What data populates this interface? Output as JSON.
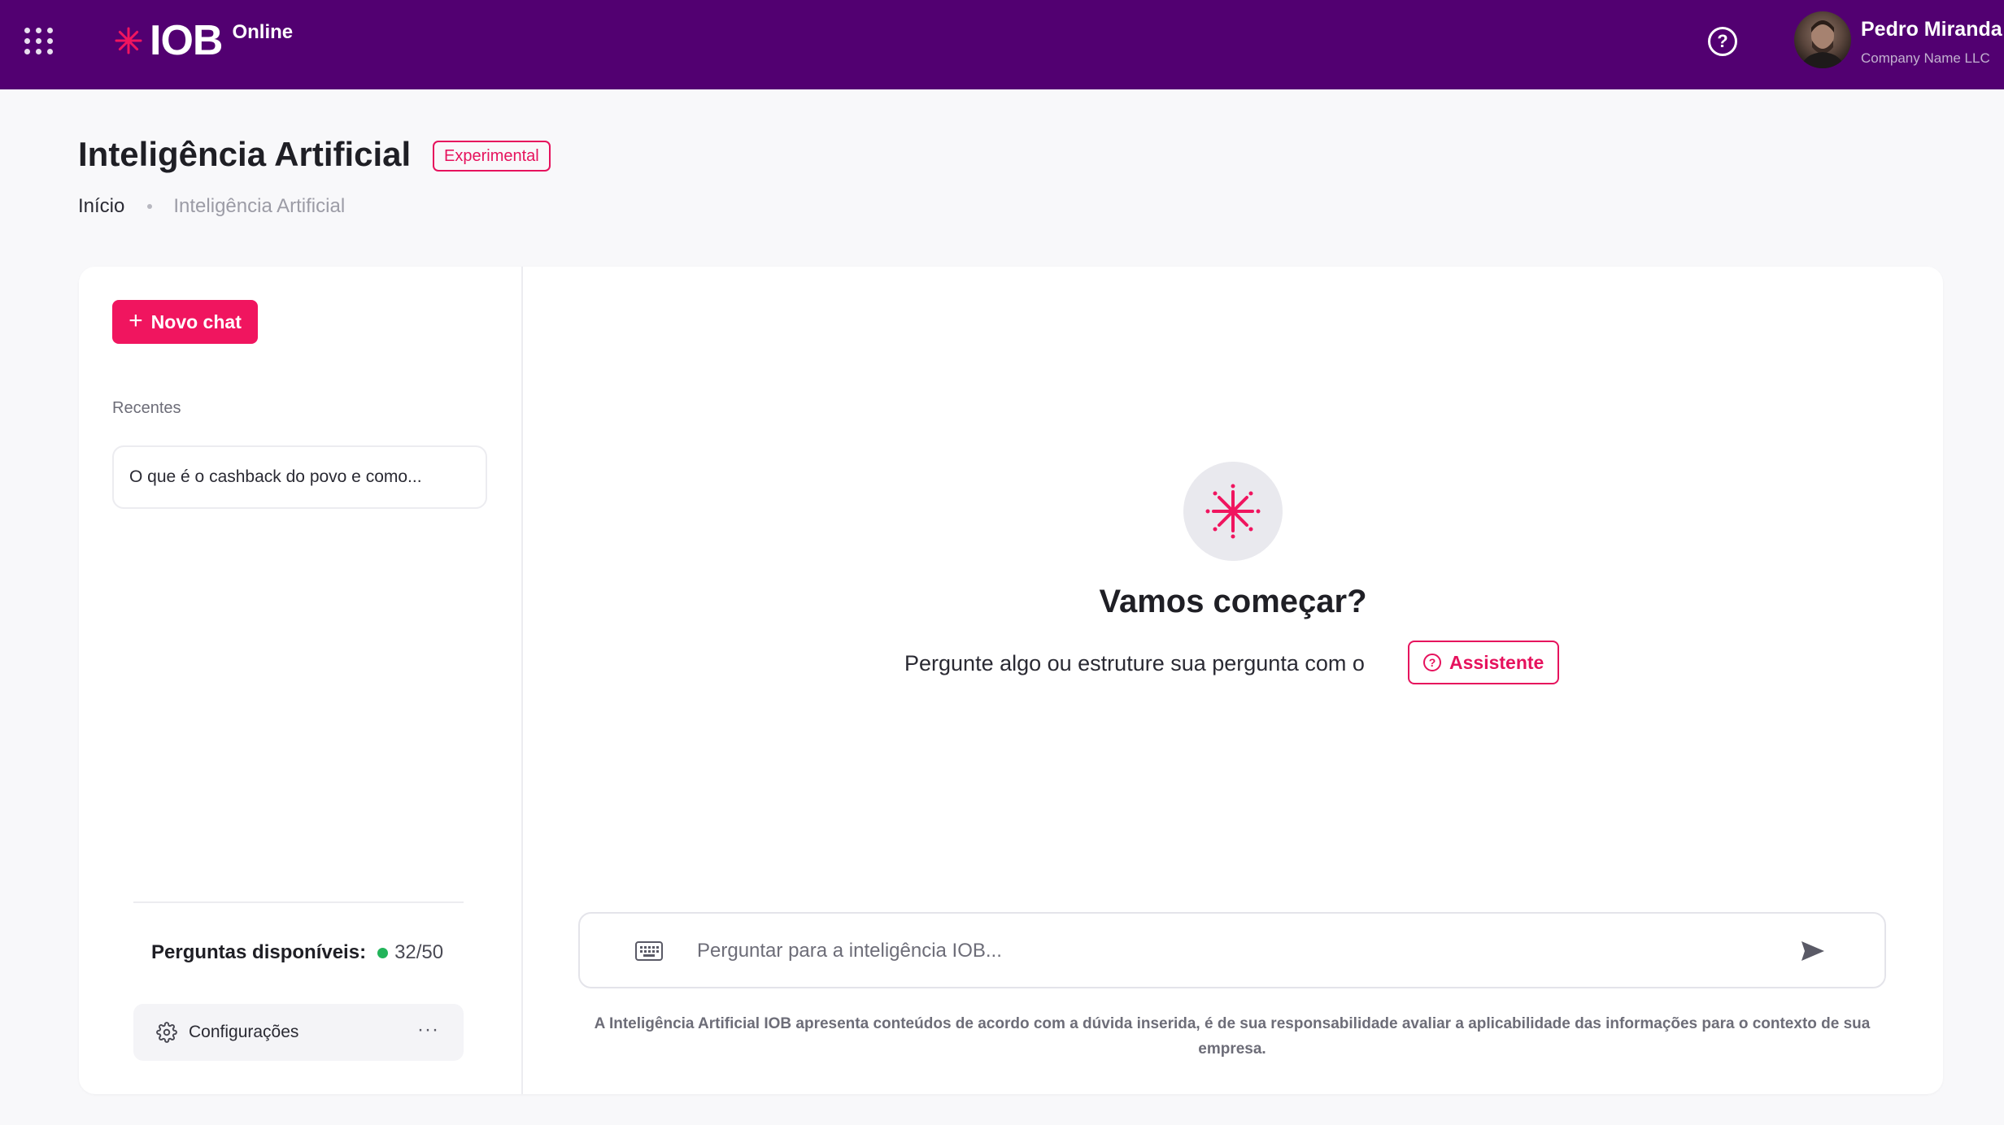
{
  "header": {
    "logo_text": "IOB",
    "logo_subtext": "Online",
    "help_symbol": "?",
    "user_name": "Pedro Miranda",
    "user_company": "Company Name LLC",
    "brand_color": "#520071",
    "accent_color": "#e6125d"
  },
  "page": {
    "title": "Inteligência Artificial",
    "badge": "Experimental",
    "breadcrumb": {
      "home": "Início",
      "current": "Inteligência Artificial"
    }
  },
  "sidebar": {
    "new_chat_label": "Novo chat",
    "recents_label": "Recentes",
    "recents": [
      {
        "title": "O que é o cashback do povo e como..."
      }
    ],
    "quota_label": "Perguntas disponíveis:",
    "quota_value": "32/50",
    "quota_status_color": "#22b45a",
    "settings_label": "Configurações",
    "more_label": "···"
  },
  "main": {
    "hero_title": "Vamos começar?",
    "hero_subtitle": "Pergunte algo ou estruture sua pergunta com o",
    "assistant_label": "Assistente",
    "input_placeholder": "Perguntar para a inteligência IOB...",
    "disclaimer": "A Inteligência Artificial IOB apresenta conteúdos de acordo com a dúvida inserida, é de sua responsabilidade avaliar a aplicabilidade das informações para o contexto de sua empresa."
  },
  "icons": {
    "apps": "grid-icon",
    "logo": "sparkle-icon",
    "help": "help-icon",
    "settings": "gear-icon",
    "keyboard": "keyboard-icon",
    "send": "send-icon",
    "hero": "sparkle-icon"
  }
}
